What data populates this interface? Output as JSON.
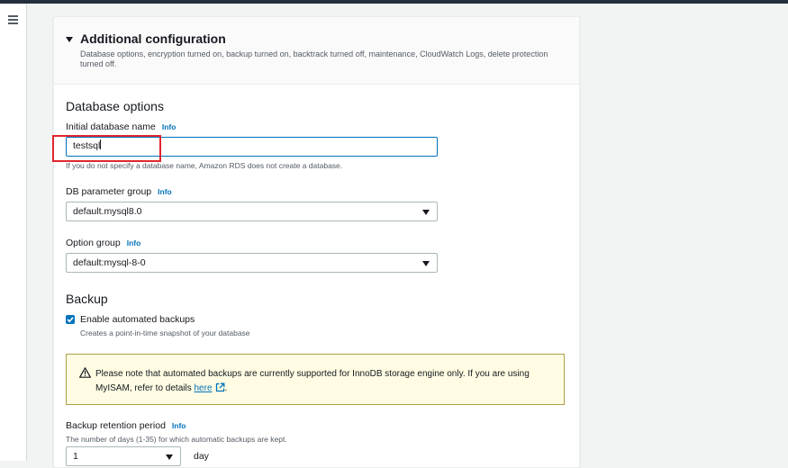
{
  "colors": {
    "accent": "#0073bb",
    "highlight_box": "#e0262e",
    "alert_bg": "#fffce3"
  },
  "nav": {
    "menu_icon": "hamburger-menu-icon"
  },
  "section": {
    "title": "Additional configuration",
    "description": "Database options, encryption turned on, backup turned on, backtrack turned off, maintenance, CloudWatch Logs, delete protection turned off."
  },
  "database_options": {
    "heading": "Database options",
    "initial_db_name": {
      "label": "Initial database name",
      "info": "Info",
      "value": "testsql",
      "hint": "If you do not specify a database name, Amazon RDS does not create a database."
    },
    "db_parameter_group": {
      "label": "DB parameter group",
      "info": "Info",
      "value": "default.mysql8.0"
    },
    "option_group": {
      "label": "Option group",
      "info": "Info",
      "value": "default:mysql-8-0"
    }
  },
  "backup": {
    "heading": "Backup",
    "enable_label": "Enable automated backups",
    "enable_checked": true,
    "enable_hint": "Creates a point-in-time snapshot of your database",
    "alert": {
      "text_before": "Please note that automated backups are currently supported for InnoDB storage engine only. If you are using MyISAM, refer to details ",
      "link": "here",
      "text_after": "."
    },
    "retention": {
      "label": "Backup retention period",
      "info": "Info",
      "hint": "The number of days (1-35) for which automatic backups are kept.",
      "value": "1",
      "unit": "day"
    }
  }
}
